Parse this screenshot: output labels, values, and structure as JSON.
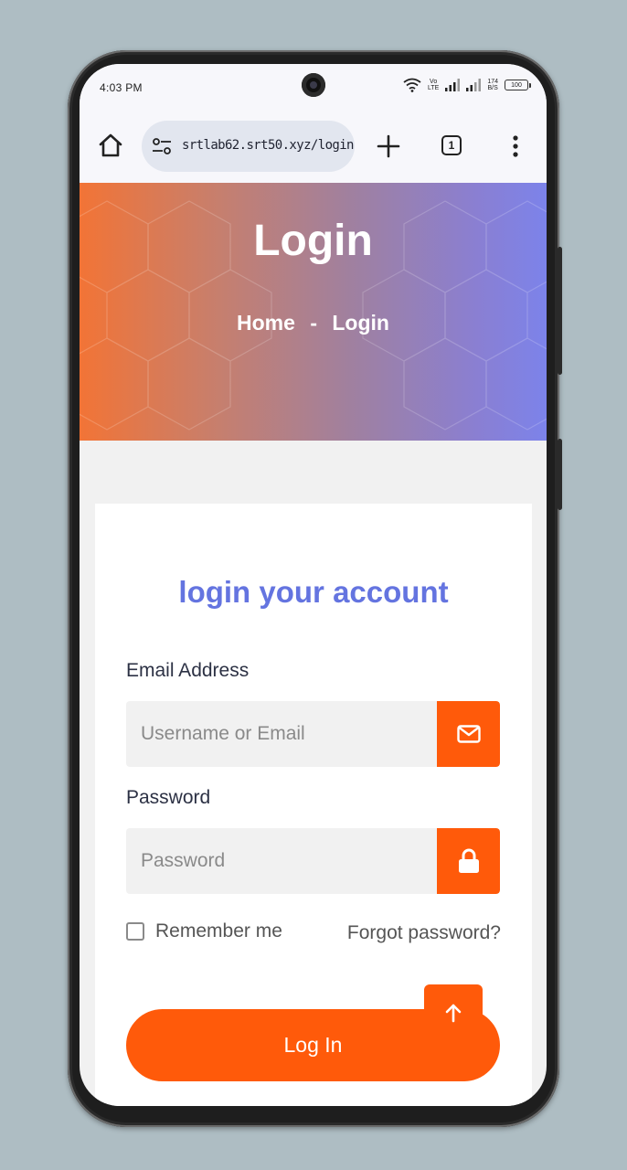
{
  "status_bar": {
    "time": "4:03 PM",
    "volte_top": "Vo",
    "volte_bottom": "LTE",
    "speed_value": "174",
    "speed_unit": "B/S",
    "battery": "100"
  },
  "browser": {
    "url": "srtlab62.srt50.xyz/login",
    "tab_count": "1"
  },
  "hero": {
    "title": "Login",
    "breadcrumb_home": "Home",
    "breadcrumb_separator": "-",
    "breadcrumb_current": "Login"
  },
  "form": {
    "title": "login your account",
    "email_label": "Email Address",
    "email_placeholder": "Username or Email",
    "password_label": "Password",
    "password_placeholder": "Password",
    "remember_label": "Remember me",
    "forgot_label": "Forgot password?",
    "login_button": "Log In"
  },
  "colors": {
    "accent": "#ff5a0a",
    "title": "#6474e0"
  },
  "icons": {
    "email": "envelope-icon",
    "password": "lock-icon",
    "scroll_top": "arrow-up-icon"
  }
}
